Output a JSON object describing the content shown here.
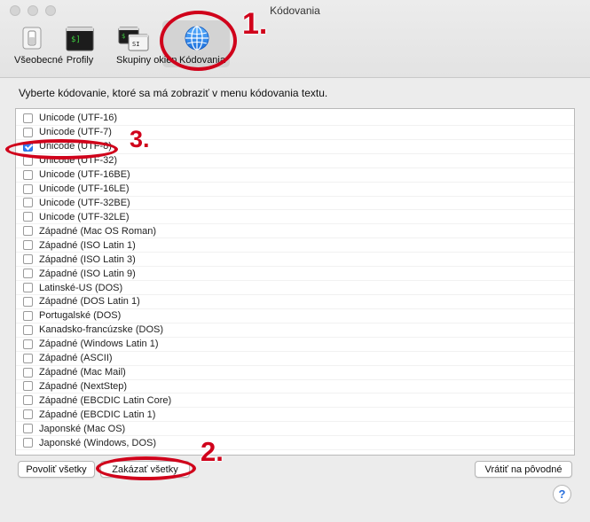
{
  "window": {
    "title": "Kódovania"
  },
  "toolbar": {
    "items": [
      {
        "label": "Všeobecné",
        "icon": "general-switch-icon"
      },
      {
        "label": "Profily",
        "icon": "terminal-profile-icon"
      },
      {
        "label": "Skupiny okien",
        "icon": "window-groups-icon"
      },
      {
        "label": "Kódovania",
        "icon": "globe-icon",
        "selected": true
      }
    ],
    "profile_glyph": "$]",
    "groups_glyph_a": "$",
    "groups_glyph_b": "SI"
  },
  "instruction": "Vyberte kódovanie, ktoré sa má zobraziť v menu kódovania textu.",
  "encodings": [
    {
      "label": "Unicode (UTF-16)",
      "checked": false
    },
    {
      "label": "Unicode (UTF-7)",
      "checked": false
    },
    {
      "label": "Unicode (UTF-8)",
      "checked": true
    },
    {
      "label": "Unicode (UTF-32)",
      "checked": false
    },
    {
      "label": "Unicode (UTF-16BE)",
      "checked": false
    },
    {
      "label": "Unicode (UTF-16LE)",
      "checked": false
    },
    {
      "label": "Unicode (UTF-32BE)",
      "checked": false
    },
    {
      "label": "Unicode (UTF-32LE)",
      "checked": false
    },
    {
      "label": "Západné (Mac OS Roman)",
      "checked": false
    },
    {
      "label": "Západné (ISO Latin 1)",
      "checked": false
    },
    {
      "label": "Západné (ISO Latin 3)",
      "checked": false
    },
    {
      "label": "Západné (ISO Latin 9)",
      "checked": false
    },
    {
      "label": "Latinské-US (DOS)",
      "checked": false
    },
    {
      "label": "Západné (DOS Latin 1)",
      "checked": false
    },
    {
      "label": "Portugalské (DOS)",
      "checked": false
    },
    {
      "label": "Kanadsko-francúzske (DOS)",
      "checked": false
    },
    {
      "label": "Západné (Windows Latin 1)",
      "checked": false
    },
    {
      "label": "Západné (ASCII)",
      "checked": false
    },
    {
      "label": "Západné (Mac Mail)",
      "checked": false
    },
    {
      "label": "Západné (NextStep)",
      "checked": false
    },
    {
      "label": "Západné (EBCDIC Latin Core)",
      "checked": false
    },
    {
      "label": "Západné (EBCDIC Latin 1)",
      "checked": false
    },
    {
      "label": "Japonské (Mac OS)",
      "checked": false
    },
    {
      "label": "Japonské (Windows, DOS)",
      "checked": false
    }
  ],
  "buttons": {
    "enable_all": "Povoliť všetky",
    "disable_all": "Zakázať všetky",
    "restore_defaults": "Vrátiť na pôvodné",
    "help": "?"
  },
  "annotations": {
    "step1": "1.",
    "step2": "2.",
    "step3": "3."
  },
  "colors": {
    "annotation": "#d0021b",
    "accent": "#2f7cf6"
  }
}
